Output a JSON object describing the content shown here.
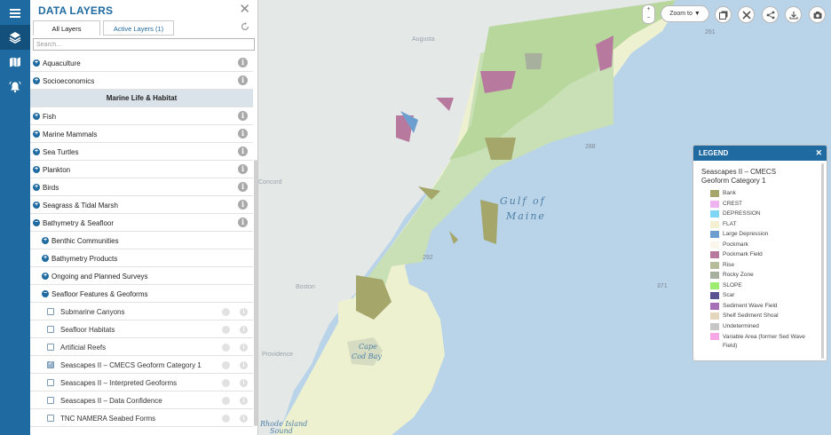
{
  "rail": {
    "items": [
      {
        "icon": "menu-icon"
      },
      {
        "icon": "layers-icon"
      },
      {
        "icon": "map-icon"
      },
      {
        "icon": "bell-icon"
      }
    ]
  },
  "panel": {
    "title": "DATA LAYERS",
    "close": "✕",
    "tabs": {
      "all": "All Layers",
      "active": "Active Layers (1)"
    },
    "search_placeholder": "Search...",
    "rows": [
      {
        "type": "group",
        "label": "Aquaculture",
        "expander": "+"
      },
      {
        "type": "group",
        "label": "Socioeconomics",
        "expander": "+"
      },
      {
        "type": "header",
        "label": "Marine Life & Habitat"
      },
      {
        "type": "group",
        "label": "Fish",
        "expander": "+"
      },
      {
        "type": "group",
        "label": "Marine Mammals",
        "expander": "+"
      },
      {
        "type": "group",
        "label": "Sea Turtles",
        "expander": "+"
      },
      {
        "type": "group",
        "label": "Plankton",
        "expander": "+"
      },
      {
        "type": "group",
        "label": "Birds",
        "expander": "+"
      },
      {
        "type": "group",
        "label": "Seagrass & Tidal Marsh",
        "expander": "+"
      },
      {
        "type": "group",
        "label": "Bathymetry & Seafloor",
        "expander": "−"
      },
      {
        "type": "sub",
        "label": "Benthic Communities",
        "expander": "+"
      },
      {
        "type": "sub",
        "label": "Bathymetry Products",
        "expander": "+"
      },
      {
        "type": "sub",
        "label": "Ongoing and Planned Surveys",
        "expander": "+"
      },
      {
        "type": "sub",
        "label": "Seafloor Features & Geoforms",
        "expander": "−"
      },
      {
        "type": "leaf",
        "label": "Submarine Canyons",
        "checked": false
      },
      {
        "type": "leaf",
        "label": "Seafloor Habitats",
        "checked": false
      },
      {
        "type": "leaf",
        "label": "Artificial Reefs",
        "checked": false
      },
      {
        "type": "leaf",
        "label": "Seascapes II – CMECS Geoform Category 1",
        "checked": true
      },
      {
        "type": "leaf",
        "label": "Seascapes II – Interpreted Geoforms",
        "checked": false
      },
      {
        "type": "leaf",
        "label": "Seascapes II – Data Confidence",
        "checked": false
      },
      {
        "type": "leaf",
        "label": "TNC NAMERA Seabed Forms",
        "checked": false
      }
    ]
  },
  "map": {
    "labels": {
      "augusta": "Augusta",
      "concord": "Concord",
      "boston": "Boston",
      "providence": "Providence",
      "gulf_line1": "Gulf of",
      "gulf_line2": "Maine",
      "cape_cod_bay_line1": "Cape",
      "cape_cod_bay_line2": "Cod Bay",
      "rhode_island_line1": "Rhode Island",
      "rhode_island_line2": "Sound",
      "route_261": "261",
      "route_288": "288",
      "route_292": "292",
      "route_371": "371"
    },
    "colors": {
      "water": "#b9d3e8",
      "land": "#e4e8e6",
      "shelf": "#eef1d0",
      "forest": "#c9dfb5"
    }
  },
  "toolbar": {
    "zoom_in": "+",
    "zoom_out": "−",
    "zoom_to": "Zoom to ▼",
    "buttons": [
      {
        "icon": "basemap-icon"
      },
      {
        "icon": "tools-icon"
      },
      {
        "icon": "share-icon"
      },
      {
        "icon": "download-icon"
      },
      {
        "icon": "camera-icon"
      }
    ]
  },
  "legend": {
    "title": "LEGEND",
    "close": "✕",
    "layer_title": "Seascapes II – CMECS Geoform Category 1",
    "items": [
      {
        "label": "Bank",
        "color": "#a4a66a"
      },
      {
        "label": "CREST",
        "color": "#efb4ef"
      },
      {
        "label": "DEPRESSION",
        "color": "#7fd6f4"
      },
      {
        "label": "FLAT",
        "color": "#f3f1d1"
      },
      {
        "label": "Large Depression",
        "color": "#6c9fcf"
      },
      {
        "label": "Pockmark",
        "color": "#fbf6ec"
      },
      {
        "label": "Pockmark Field",
        "color": "#b77a9e"
      },
      {
        "label": "Rise",
        "color": "#b7bc9a"
      },
      {
        "label": "Rocky Zone",
        "color": "#a7b09d"
      },
      {
        "label": "SLOPE",
        "color": "#9bec6f"
      },
      {
        "label": "Scar",
        "color": "#5b5391"
      },
      {
        "label": "Sediment Wave Field",
        "color": "#a66fb6"
      },
      {
        "label": "Shelf Sediment Shoal",
        "color": "#e3d6bd"
      },
      {
        "label": "Undetermined",
        "color": "#c6c6c6"
      },
      {
        "label": "Variable Area (former Sed Wave Field)",
        "color": "#f6a7e6"
      }
    ]
  }
}
